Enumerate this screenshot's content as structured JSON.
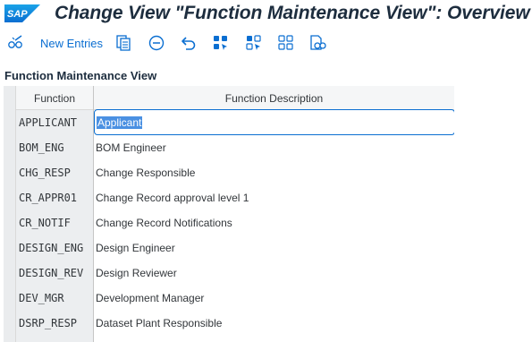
{
  "app": {
    "logo_text": "SAP",
    "title": "Change View \"Function Maintenance View\": Overview",
    "brand_color": "#0a6ed1"
  },
  "toolbar": {
    "new_entries_label": "New Entries",
    "icons": [
      "glasses-pen-icon",
      "copy-icon",
      "delete-icon",
      "undo-icon",
      "select-all-icon",
      "select-block-icon",
      "deselect-all-icon",
      "choose-detail-icon"
    ]
  },
  "section": {
    "title": "Function Maintenance View"
  },
  "table": {
    "columns": [
      "Function",
      "Function Description"
    ],
    "rows": [
      {
        "function": "APPLICANT",
        "description": "Applicant"
      },
      {
        "function": "BOM_ENG",
        "description": "BOM Engineer"
      },
      {
        "function": "CHG_RESP",
        "description": "Change Responsible"
      },
      {
        "function": "CR_APPR01",
        "description": "Change Record approval level 1"
      },
      {
        "function": "CR_NOTIF",
        "description": "Change Record Notifications"
      },
      {
        "function": "DESIGN_ENG",
        "description": "Design Engineer"
      },
      {
        "function": "DESIGN_REV",
        "description": "Design Reviewer"
      },
      {
        "function": "DEV_MGR",
        "description": "Development Manager"
      },
      {
        "function": "DSRP_RESP",
        "description": "Dataset Plant Responsible"
      },
      {
        "function": "",
        "description": ""
      }
    ]
  }
}
